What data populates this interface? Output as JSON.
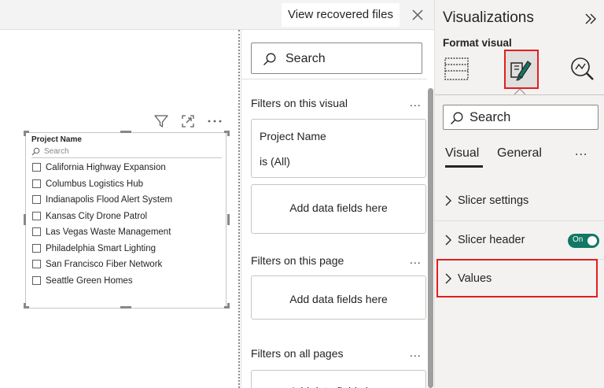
{
  "topbar": {
    "recovered_label": "View recovered files"
  },
  "slicer": {
    "title": "Project Name",
    "search_placeholder": "Search",
    "items": [
      "California Highway Expansion",
      "Columbus Logistics Hub",
      "Indianapolis Flood Alert System",
      "Kansas City Drone Patrol",
      "Las Vegas Waste Management",
      "Philadelphia Smart Lighting",
      "San Francisco Fiber Network",
      "Seattle Green Homes"
    ]
  },
  "filters": {
    "search_label": "Search",
    "on_this_visual": "Filters on this visual",
    "filter_field": "Project Name",
    "filter_condition": "is (All)",
    "add_fields": "Add data fields here",
    "on_this_page": "Filters on this page",
    "on_all_pages": "Filters on all pages",
    "more": "..."
  },
  "visualizations": {
    "title": "Visualizations",
    "subtitle": "Format visual",
    "search_label": "Search",
    "tabs": [
      "Visual",
      "General"
    ],
    "more": "...",
    "sections": [
      {
        "label": "Slicer settings"
      },
      {
        "label": "Slicer header",
        "toggle": "On"
      },
      {
        "label": "Values"
      }
    ],
    "colors": {
      "toggle": "#117865",
      "highlight": "#e31d1d"
    }
  }
}
